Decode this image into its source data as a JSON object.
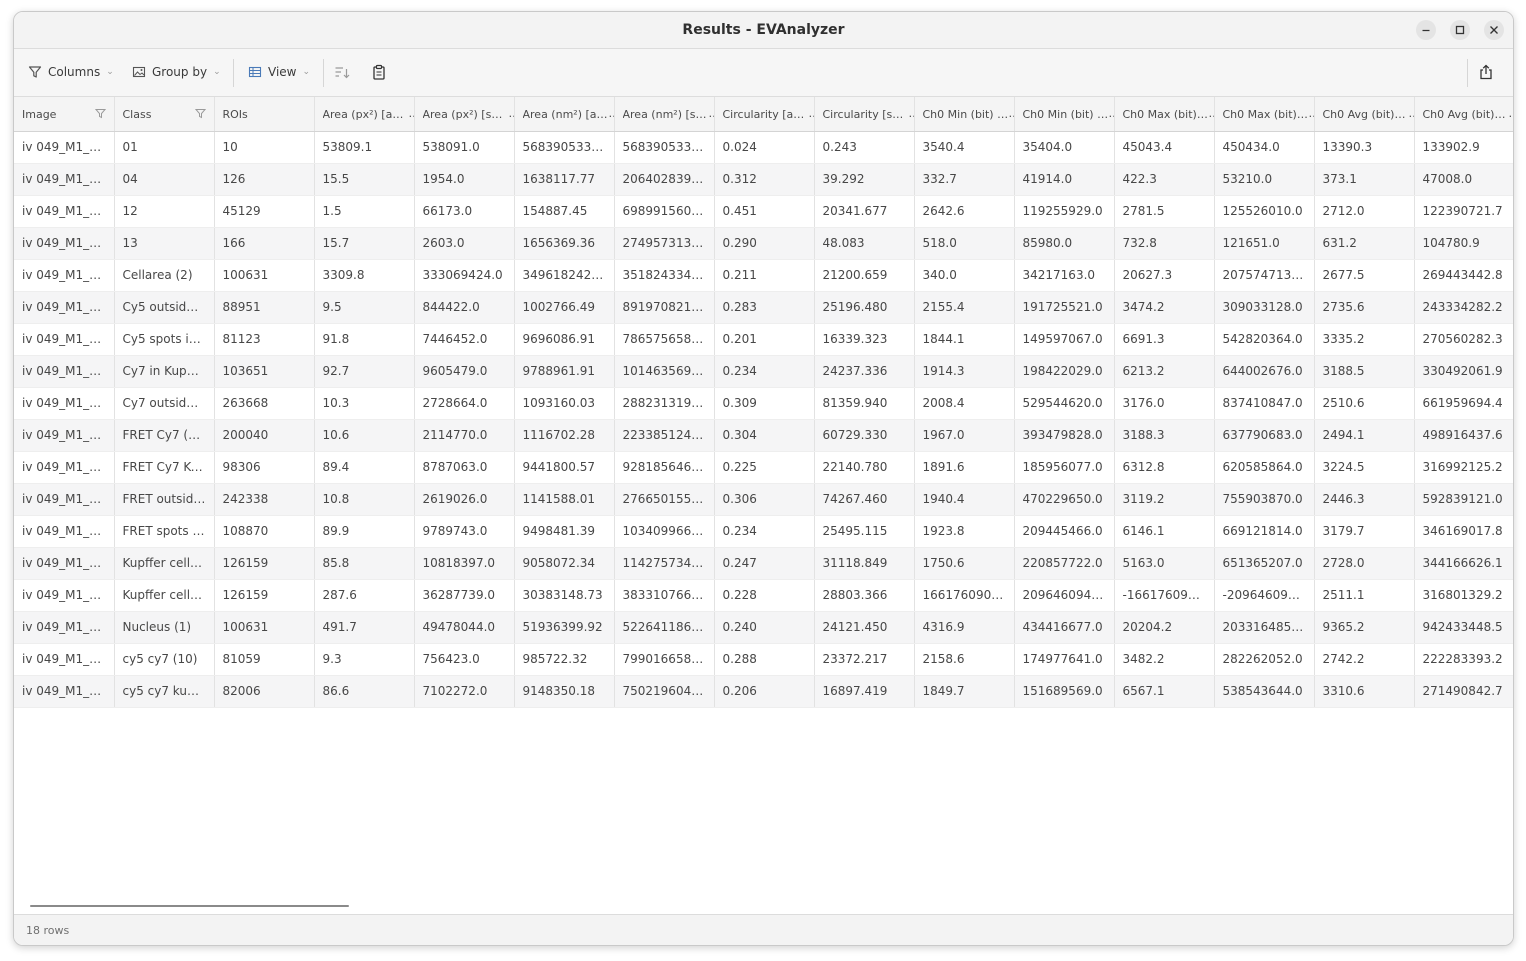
{
  "window": {
    "title": "Results - EVAnalyzer",
    "minimize_icon": "minimize-icon",
    "maximize_icon": "maximize-icon",
    "close_icon": "close-icon"
  },
  "toolbar": {
    "columns_label": "Columns",
    "group_by_label": "Group by",
    "view_label": "View"
  },
  "table": {
    "headers": [
      "Image",
      "Class",
      "ROIs",
      "Area (px²) [avg]",
      "Area (px²) [sum]",
      "Area (nm²) [avg]",
      "Area (nm²) [sum]",
      "Circularity [avg]",
      "Circularity [sum]",
      "Ch0 Min (bit) [a...",
      "Ch0 Min (bit) [s...",
      "Ch0 Max (bit) [...",
      "Ch0 Max (bit) [...",
      "Ch0 Avg (bit) [a...",
      "Ch0 Avg (bit) [s..."
    ],
    "rows": [
      [
        "iv 049_M1_L_...",
        "01",
        "10",
        "53809.1",
        "538091.0",
        "5683905338.64",
        "56839053386...",
        "0.024",
        "0.243",
        "3540.4",
        "35404.0",
        "45043.4",
        "450434.0",
        "13390.3",
        "133902.9"
      ],
      [
        "iv 049_M1_L_...",
        "04",
        "126",
        "15.5",
        "1954.0",
        "1638117.77",
        "206402839.51",
        "0.312",
        "39.292",
        "332.7",
        "41914.0",
        "422.3",
        "53210.0",
        "373.1",
        "47008.0"
      ],
      [
        "iv 049_M1_L_...",
        "12",
        "45129",
        "1.5",
        "66173.0",
        "154887.45",
        "6989915608.59",
        "0.451",
        "20341.677",
        "2642.6",
        "119255929.0",
        "2781.5",
        "125526010.0",
        "2712.0",
        "122390721.7"
      ],
      [
        "iv 049_M1_L_...",
        "13",
        "166",
        "15.7",
        "2603.0",
        "1656369.36",
        "274957313.85",
        "0.290",
        "48.083",
        "518.0",
        "85980.0",
        "732.8",
        "121651.0",
        "631.2",
        "104780.9"
      ],
      [
        "iv 049_M1_L_...",
        "Cellarea (2)",
        "100631",
        "3309.8",
        "333069424.0",
        "349618242.91",
        "35182433402...",
        "0.211",
        "21200.659",
        "340.0",
        "34217163.0",
        "20627.3",
        "2075747134.0",
        "2677.5",
        "269443442.8"
      ],
      [
        "iv 049_M1_L_...",
        "Cy5 outside K...",
        "88951",
        "9.5",
        "844422.0",
        "1002766.49",
        "89197082163...",
        "0.283",
        "25196.480",
        "2155.4",
        "191725521.0",
        "3474.2",
        "309033128.0",
        "2735.6",
        "243334282.2"
      ],
      [
        "iv 049_M1_L_...",
        "Cy5 spots in ...",
        "81123",
        "91.8",
        "7446452.0",
        "9696086.91",
        "78657565870...",
        "0.201",
        "16339.323",
        "1844.1",
        "149597067.0",
        "6691.3",
        "542820364.0",
        "3335.2",
        "270560282.3"
      ],
      [
        "iv 049_M1_L_...",
        "Cy7 in Kupffe...",
        "103651",
        "92.7",
        "9605479.0",
        "9788961.91",
        "10146356911...",
        "0.234",
        "24237.336",
        "1914.3",
        "198422029.0",
        "6213.2",
        "644002676.0",
        "3188.5",
        "330492061.9"
      ],
      [
        "iv 049_M1_L_...",
        "Cy7 outside K...",
        "263668",
        "10.3",
        "2728664.0",
        "1093160.03",
        "28823131918...",
        "0.309",
        "81359.940",
        "2008.4",
        "529544620.0",
        "3176.0",
        "837410847.0",
        "2510.6",
        "661959694.4"
      ],
      [
        "iv 049_M1_L_...",
        "FRET Cy7 (20)",
        "200040",
        "10.6",
        "2114770.0",
        "1116702.28",
        "22338512431...",
        "0.304",
        "60729.330",
        "1967.0",
        "393479828.0",
        "3188.3",
        "637790683.0",
        "2494.1",
        "498916437.6"
      ],
      [
        "iv 049_M1_L_...",
        "FRET Cy7 Kup...",
        "98306",
        "89.4",
        "8787063.0",
        "9441800.57",
        "92818564697...",
        "0.225",
        "22140.780",
        "1891.6",
        "185956077.0",
        "6312.8",
        "620585864.0",
        "3224.5",
        "316992125.2"
      ],
      [
        "iv 049_M1_L_...",
        "FRET outside ...",
        "242338",
        "10.8",
        "2619026.0",
        "1141588.01",
        "27665015514...",
        "0.306",
        "74267.460",
        "1940.4",
        "470229650.0",
        "3119.2",
        "755903870.0",
        "2446.3",
        "592839121.0"
      ],
      [
        "iv 049_M1_L_...",
        "FRET spots in...",
        "108870",
        "89.9",
        "9789743.0",
        "9498481.39",
        "10340996690...",
        "0.234",
        "25495.115",
        "1923.8",
        "209445466.0",
        "6146.1",
        "669121814.0",
        "3179.7",
        "346169017.8"
      ],
      [
        "iv 049_M1_L_...",
        "Kupffer cell (3)",
        "126159",
        "85.8",
        "10818397.0",
        "9058072.34",
        "11427573489...",
        "0.247",
        "31118.849",
        "1750.6",
        "220857722.0",
        "5163.0",
        "651365207.0",
        "2728.0",
        "344166626.1"
      ],
      [
        "iv 049_M1_L_...",
        "Kupffer cells ...",
        "126159",
        "287.6",
        "36287739.0",
        "30383148.73",
        "38331076607...",
        "0.228",
        "28803.366",
        "16617609058...",
        "20964609412...",
        "-1661760905...",
        "-2096460941...",
        "2511.1",
        "316801329.2"
      ],
      [
        "iv 049_M1_L_...",
        "Nucleus (1)",
        "100631",
        "491.7",
        "49478044.0",
        "51936399.92",
        "52264118603...",
        "0.240",
        "24121.450",
        "4316.9",
        "434416677.0",
        "20204.2",
        "2033164854.0",
        "9365.2",
        "942433448.5"
      ],
      [
        "iv 049_M1_L_...",
        "cy5 cy7 (10)",
        "81059",
        "9.3",
        "756423.0",
        "985722.32",
        "79901665851...",
        "0.288",
        "23372.217",
        "2158.6",
        "174977641.0",
        "3482.2",
        "282262052.0",
        "2742.2",
        "222283393.2"
      ],
      [
        "iv 049_M1_L_...",
        "cy5 cy7 kupff...",
        "82006",
        "86.6",
        "7102272.0",
        "9148350.18",
        "75021960481...",
        "0.206",
        "16897.419",
        "1849.7",
        "151689569.0",
        "6567.1",
        "538543644.0",
        "3310.6",
        "271490842.7"
      ]
    ]
  },
  "status": {
    "row_count": "18 rows"
  }
}
